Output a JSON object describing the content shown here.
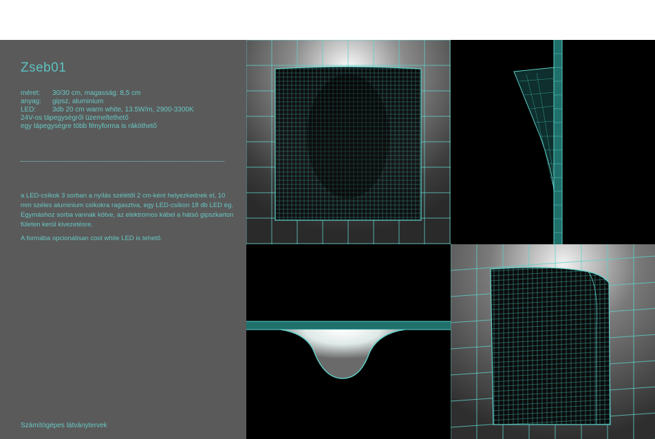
{
  "product": {
    "title": "Zseb01"
  },
  "specs": [
    {
      "key": "méret:",
      "value": "30/30 cm, magasság:  8,5 cm"
    },
    {
      "key": "anyag:",
      "value": "gipsz, aluminium"
    },
    {
      "key": "LED:",
      "value": "3db 20 cm warm white, 13.5W/m, 2900-3300K"
    }
  ],
  "notes": [
    "24V-os tápegységről üzemeltethető",
    "egy tápegységre több fényforma is ráköthető"
  ],
  "description": {
    "paragraph1": "a LED-csíkok 3 sorban a nyílás szélétől  2 cm-ként helyezkednek el, 10 mm széles aluminium csíkokra ragasztva, egy LED-csíkon 18 db  LED ég. Egymáshoz sorba vannak kötve, az elektromos kábel a hátsó gipszkarton fületen kerül  kivezetésre.",
    "paragraph2": "A formába opcionálisan cool white LED is tehető."
  },
  "footer": {
    "caption": "Számítógépes látványtervek"
  },
  "colors": {
    "accent": "#68c7c2",
    "panel": "#5a5a5a",
    "mesh": "#3fb8b0"
  }
}
